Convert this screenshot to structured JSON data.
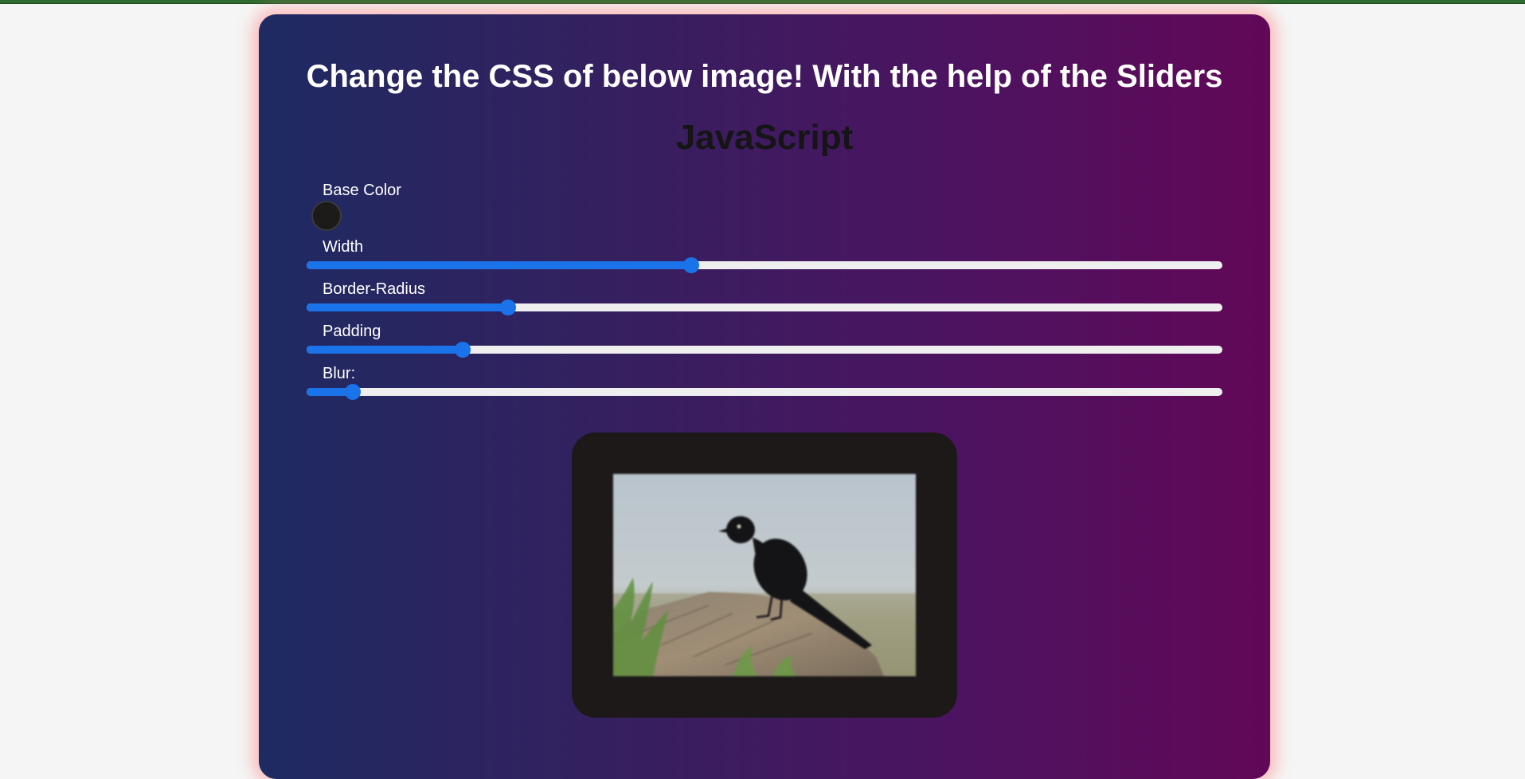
{
  "page": {
    "title": "Change the CSS of below image! With the help of the Sliders",
    "subtitle": "JavaScript"
  },
  "controls": {
    "base_color": {
      "label": "Base Color",
      "value": "#1d1a1a"
    },
    "sliders": [
      {
        "label": "Width",
        "fraction": 0.42
      },
      {
        "label": "Border-Radius",
        "fraction": 0.22
      },
      {
        "label": "Padding",
        "fraction": 0.17
      },
      {
        "label": "Blur:",
        "fraction": 0.05
      }
    ]
  },
  "image": {
    "subject": "bird-photo"
  },
  "colors": {
    "accent": "#1a73e8",
    "gradient_start": "#1e2a62",
    "gradient_end": "#610857",
    "frame": "#1c1918"
  }
}
